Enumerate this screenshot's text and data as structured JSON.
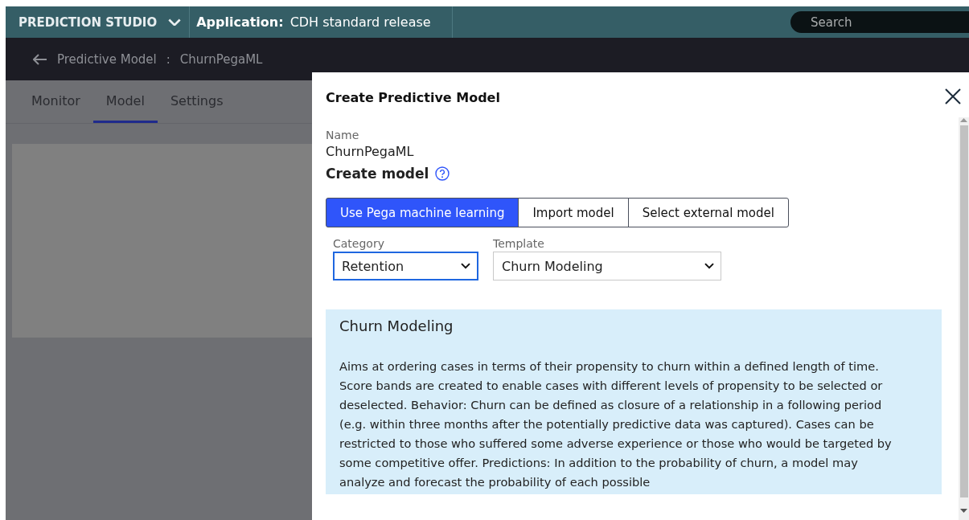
{
  "header": {
    "brand": "PREDICTION STUDIO",
    "application_label": "Application:",
    "application_name": "CDH standard release",
    "search": {
      "placeholder": "Search"
    }
  },
  "breadcrumb": {
    "section": "Predictive Model",
    "separator": ":",
    "name": "ChurnPegaML"
  },
  "tabs": [
    {
      "label": "Monitor",
      "selected": false
    },
    {
      "label": "Model",
      "selected": true
    },
    {
      "label": "Settings",
      "selected": false
    }
  ],
  "dialog": {
    "title": "Create Predictive Model",
    "name_label": "Name",
    "name_value": "ChurnPegaML",
    "section_title": "Create model",
    "model_sources": [
      {
        "label": "Use Pega machine learning",
        "selected": true
      },
      {
        "label": "Import model",
        "selected": false
      },
      {
        "label": "Select external model",
        "selected": false
      }
    ],
    "selects": [
      {
        "label": "Category",
        "value": "Retention",
        "focused": true
      },
      {
        "label": "Template",
        "value": "Churn Modeling",
        "focused": false
      }
    ],
    "template_info": {
      "title": "Churn Modeling",
      "description": "Aims at ordering cases in terms of their propensity to churn within a defined length of time. Score bands are created to enable cases with different levels of propensity to be selected or deselected. Behavior: Churn can be defined as closure of a relationship in a following period (e.g. within three months after the potentially predictive data was captured). Cases can be restricted to those who suffered some adverse experience or those who would be targeted by some competitive offer. Predictions: In addition to the probability of churn, a model may analyze and forecast the probability of each possible"
    }
  }
}
